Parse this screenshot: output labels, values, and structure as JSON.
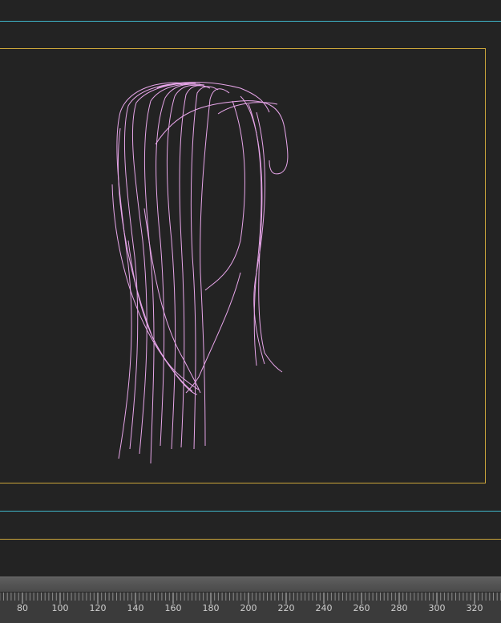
{
  "viewport": {
    "guide_color": "#3fb6c9",
    "safe_frame_color": "#c9a43a",
    "curve_color": "#e8a6ea",
    "background": "#232323"
  },
  "timeline": {
    "ticks": [
      "80",
      "100",
      "120",
      "140",
      "160",
      "180",
      "200",
      "220",
      "240",
      "260",
      "280",
      "300",
      "320"
    ]
  }
}
